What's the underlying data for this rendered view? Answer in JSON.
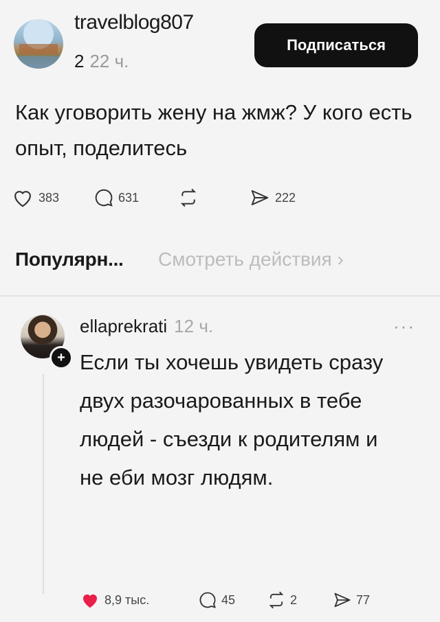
{
  "post": {
    "username": "travelblog807",
    "counter": "2",
    "time": "22 ч.",
    "subscribe_label": "Подписаться",
    "text": "Как уговорить жену на жмж? У кого есть опыт, поделитесь",
    "likes": "383",
    "comments": "631",
    "shares": "222"
  },
  "popular": {
    "title": "Популярн...",
    "link": "Смотреть действия ›"
  },
  "comment": {
    "username": "ellaprekrati",
    "time": "12 ч.",
    "more": "···",
    "text": "Если ты хочешь увидеть сразу двух разочарованных в тебе людей - съезди к родителям и не еби мозг людям.",
    "likes": "8,9 тыс.",
    "replies": "45",
    "reposts": "2",
    "shares": "77"
  },
  "colors": {
    "like_active": "#e8204a",
    "button_bg": "#111111"
  }
}
